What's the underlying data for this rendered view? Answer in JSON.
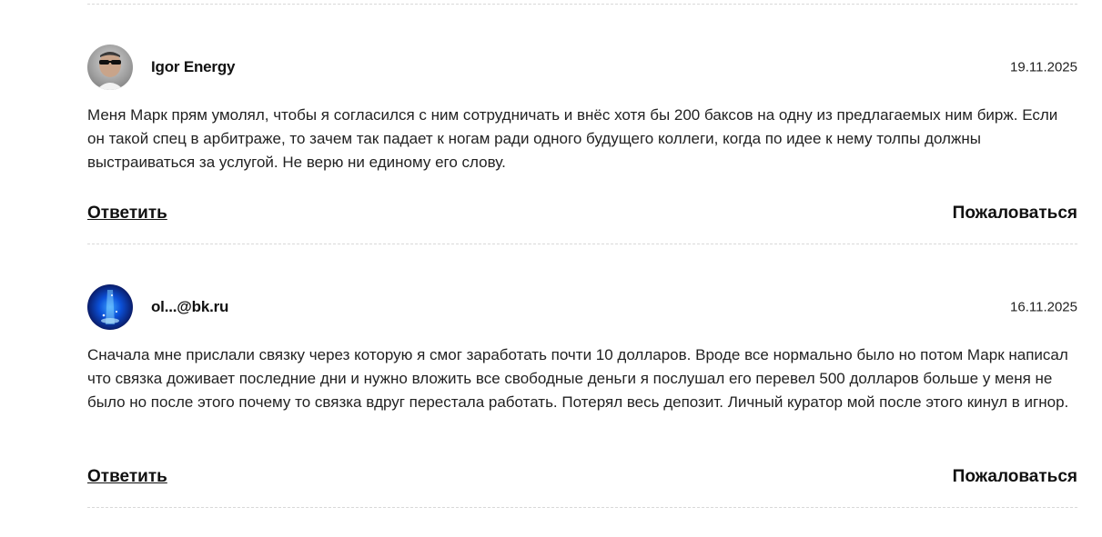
{
  "comments": [
    {
      "author": "Igor Energy",
      "date": "19.11.2025",
      "text": "Меня Марк прям умолял, чтобы я согласился с ним сотрудничать и внёс хотя бы 200 баксов на одну из предлагаемых ним бирж. Если он такой спец в арбитраже, то зачем так падает к ногам ради одного будущего коллеги, когда по идее к нему толпы должны выстраиваться за услугой. Не верю ни единому его слову.",
      "reply_label": "Ответить",
      "complain_label": "Пожаловаться"
    },
    {
      "author": "ol...@bk.ru",
      "date": "16.11.2025",
      "text": "Сначала мне прислали связку через которую я смог заработать почти 10 долларов. Вроде все нормально было но потом Марк написал что связка доживает последние дни и нужно вложить все свободные деньги я послушал его перевел 500 долларов больше у меня не было но после этого почему то связка вдруг перестала работать. Потерял весь депозит. Личный куратор мой после этого кинул в игнор.",
      "reply_label": "Ответить",
      "complain_label": "Пожаловаться"
    }
  ]
}
